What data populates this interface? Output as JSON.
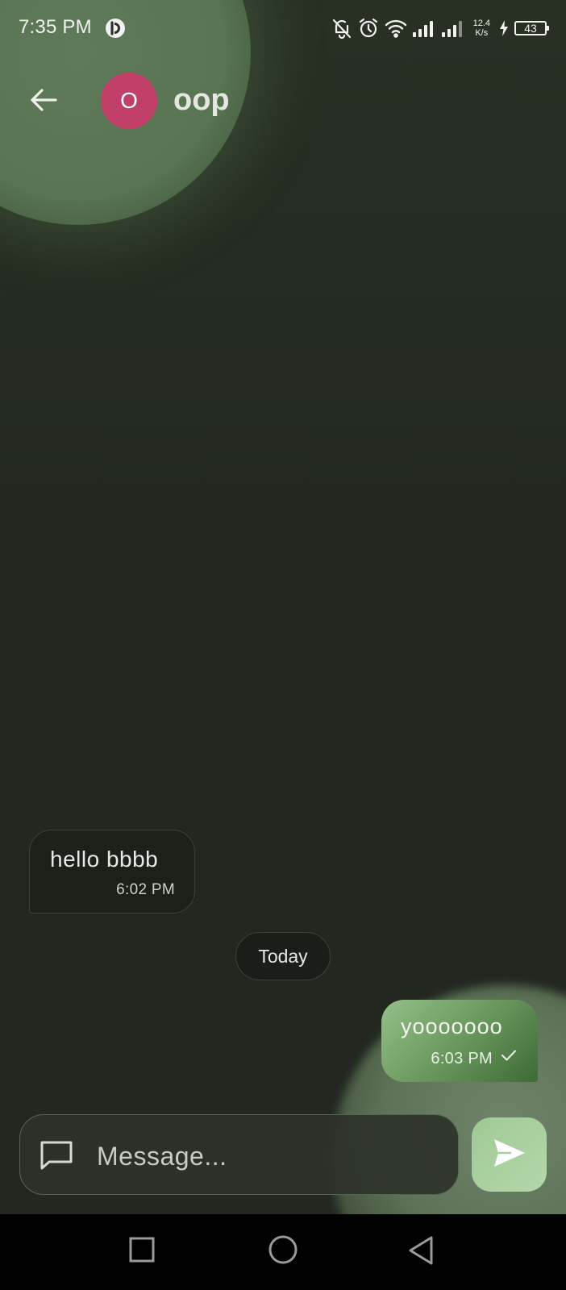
{
  "status_bar": {
    "time": "7:35 PM",
    "net_speed_value": "12.4",
    "net_speed_unit": "K/s",
    "battery_level": "43",
    "icons": [
      "app-indicator-icon",
      "bell-off-icon",
      "alarm-icon",
      "wifi-icon",
      "signal-icon",
      "signal-icon",
      "charging-icon",
      "battery-icon"
    ]
  },
  "header": {
    "avatar_initial": "O",
    "avatar_color": "#c0406a",
    "contact_name": "oop",
    "back_icon": "arrow-left-icon"
  },
  "messages": [
    {
      "direction": "incoming",
      "text": "hello bbbb",
      "time": "6:02 PM"
    },
    {
      "direction": "outgoing",
      "text": "yooooooo",
      "time": "6:03 PM",
      "status_icon": "check-icon"
    }
  ],
  "date_separator": "Today",
  "composer": {
    "placeholder": "Message...",
    "icon": "message-square-icon",
    "send_icon": "send-icon",
    "accent": "#a7cf9c"
  },
  "nav_bar": {
    "buttons": [
      "recents-square-icon",
      "home-circle-icon",
      "back-triangle-icon"
    ]
  },
  "colors": {
    "background": "#222720",
    "outgoing_bubble": "#6e9c62",
    "incoming_bubble": "#1b2019"
  }
}
